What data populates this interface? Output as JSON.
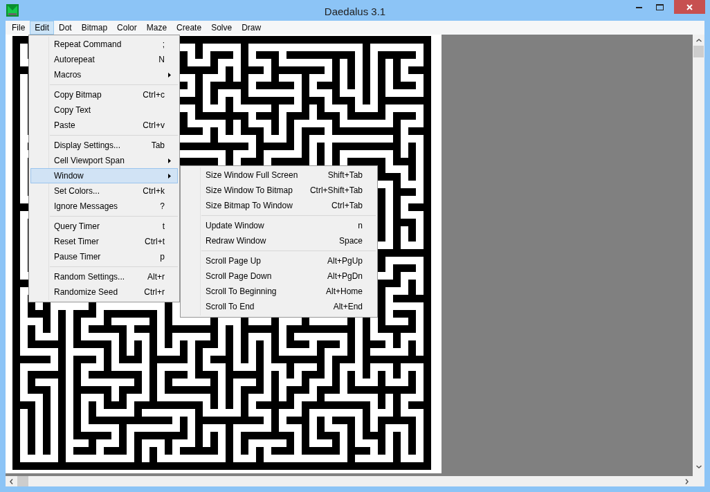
{
  "window": {
    "title": "Daedalus 3.1"
  },
  "menu_bar": [
    {
      "label": "File",
      "selected": false
    },
    {
      "label": "Edit",
      "selected": true
    },
    {
      "label": "Dot",
      "selected": false
    },
    {
      "label": "Bitmap",
      "selected": false
    },
    {
      "label": "Color",
      "selected": false
    },
    {
      "label": "Maze",
      "selected": false
    },
    {
      "label": "Create",
      "selected": false
    },
    {
      "label": "Solve",
      "selected": false
    },
    {
      "label": "Draw",
      "selected": false
    }
  ],
  "edit_menu": {
    "groups": [
      [
        {
          "label": "Repeat Command",
          "shortcut": ";",
          "submenu": false,
          "selected": false
        },
        {
          "label": "Autorepeat",
          "shortcut": "N",
          "submenu": false,
          "selected": false
        },
        {
          "label": "Macros",
          "submenu": true,
          "selected": false
        }
      ],
      [
        {
          "label": "Copy Bitmap",
          "shortcut": "Ctrl+c",
          "submenu": false,
          "selected": false
        },
        {
          "label": "Copy Text",
          "submenu": false,
          "selected": false
        },
        {
          "label": "Paste",
          "shortcut": "Ctrl+v",
          "submenu": false,
          "selected": false
        }
      ],
      [
        {
          "label": "Display Settings...",
          "shortcut": "Tab",
          "submenu": false,
          "selected": false
        },
        {
          "label": "Cell Viewport Span",
          "submenu": true,
          "selected": false
        },
        {
          "label": "Window",
          "submenu": true,
          "selected": true
        },
        {
          "label": "Set Colors...",
          "shortcut": "Ctrl+k",
          "submenu": false,
          "selected": false
        },
        {
          "label": "Ignore Messages",
          "shortcut": "?",
          "submenu": false,
          "selected": false
        }
      ],
      [
        {
          "label": "Query Timer",
          "shortcut": "t",
          "submenu": false,
          "selected": false
        },
        {
          "label": "Reset Timer",
          "shortcut": "Ctrl+t",
          "submenu": false,
          "selected": false
        },
        {
          "label": "Pause Timer",
          "shortcut": "p",
          "submenu": false,
          "selected": false
        }
      ],
      [
        {
          "label": "Random Settings...",
          "shortcut": "Alt+r",
          "submenu": false,
          "selected": false
        },
        {
          "label": "Randomize Seed",
          "shortcut": "Ctrl+r",
          "submenu": false,
          "selected": false
        }
      ]
    ]
  },
  "window_submenu": {
    "groups": [
      [
        {
          "label": "Size Window Full Screen",
          "shortcut": "Shift+Tab",
          "submenu": false,
          "selected": false
        },
        {
          "label": "Size Window To Bitmap",
          "shortcut": "Ctrl+Shift+Tab",
          "submenu": false,
          "selected": false
        },
        {
          "label": "Size Bitmap To Window",
          "shortcut": "Ctrl+Tab",
          "submenu": false,
          "selected": false
        }
      ],
      [
        {
          "label": "Update Window",
          "shortcut": "n",
          "submenu": false,
          "selected": false
        },
        {
          "label": "Redraw Window",
          "shortcut": "Space",
          "submenu": false,
          "selected": false
        }
      ],
      [
        {
          "label": "Scroll Page Up",
          "shortcut": "Alt+PgUp",
          "submenu": false,
          "selected": false
        },
        {
          "label": "Scroll Page Down",
          "shortcut": "Alt+PgDn",
          "submenu": false,
          "selected": false
        },
        {
          "label": "Scroll To Beginning",
          "shortcut": "Alt+Home",
          "submenu": false,
          "selected": false
        },
        {
          "label": "Scroll To End",
          "shortcut": "Alt+End",
          "submenu": false,
          "selected": false
        }
      ]
    ]
  }
}
